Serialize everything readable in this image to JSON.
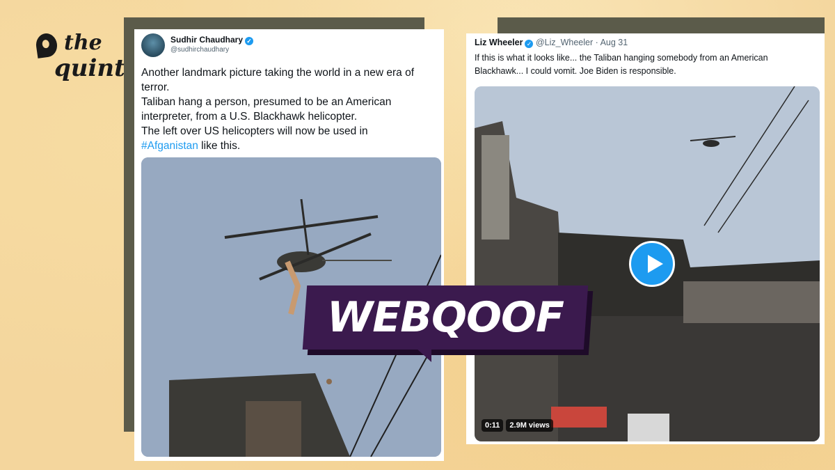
{
  "brand": {
    "line1": "the",
    "line2": "quint"
  },
  "tweet_left": {
    "author": "Sudhir Chaudhary",
    "handle": "@sudhirchaudhary",
    "text_lines": [
      "Another landmark picture taking the world in a new era of",
      "terror.",
      "Taliban hang a person, presumed to be an American",
      "interpreter, from a U.S. Blackhawk helicopter.",
      "The left over US helicopters will now be used in"
    ],
    "hashtag": "#Afganistan",
    "tail": " like this."
  },
  "tweet_right": {
    "author": "Liz Wheeler",
    "handle": "@Liz_Wheeler",
    "separator": "·",
    "date": "Aug 31",
    "text_lines": [
      "If this is what it looks like... the Taliban hanging somebody from an American",
      "Blackhawk... I could vomit. Joe Biden is responsible."
    ],
    "video_time": "0:11",
    "video_views": "2.9M views"
  },
  "stamp": {
    "label": "WEBQOOF"
  },
  "colors": {
    "link": "#1d9bf0",
    "stamp_bg": "#3b1a4e",
    "frame": "#5b5b4a",
    "background": "#f4d69d"
  }
}
